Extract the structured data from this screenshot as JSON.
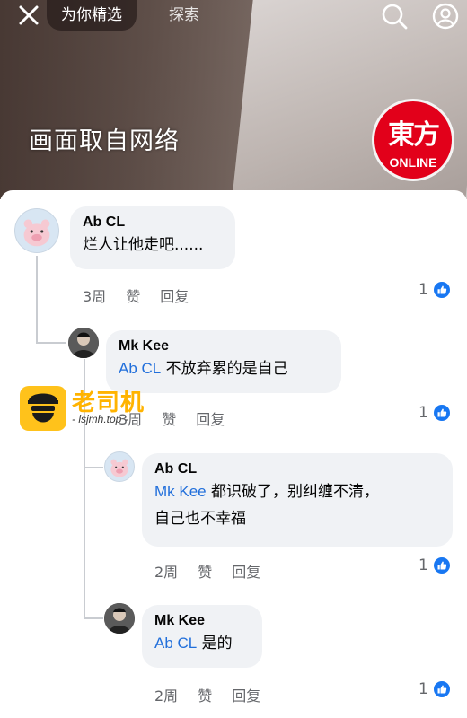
{
  "video": {
    "tab_active": "为你精选",
    "tab_explore": "探索",
    "overlay_text": "画面取自网络",
    "logo_top": "東方",
    "logo_bottom": "ONLINE"
  },
  "comments": [
    {
      "author": "Ab CL",
      "mention": "",
      "text": "烂人让他走吧......",
      "time": "3周",
      "like_label": "赞",
      "reply_label": "回复",
      "reactions": "1"
    },
    {
      "author": "Mk Kee",
      "mention": "Ab CL",
      "text": "不放弃累的是自己",
      "time": "3周",
      "like_label": "赞",
      "reply_label": "回复",
      "reactions": "1"
    },
    {
      "author": "Ab CL",
      "mention": "Mk Kee",
      "text": "都识破了，别纠缠不清，",
      "text2": "自己也不幸福",
      "time": "2周",
      "like_label": "赞",
      "reply_label": "回复",
      "reactions": "1"
    },
    {
      "author": "Mk Kee",
      "mention": "Ab CL",
      "text": "是的",
      "time": "2周",
      "like_label": "赞",
      "reply_label": "回复",
      "reactions": "1"
    }
  ],
  "watermark": {
    "title": "老司机",
    "url": "- lsjmh.top -"
  },
  "colors": {
    "mention": "#216fdb",
    "like_badge": "#1877f2",
    "bubble": "#f0f2f5",
    "logo_red": "#e2001a"
  }
}
